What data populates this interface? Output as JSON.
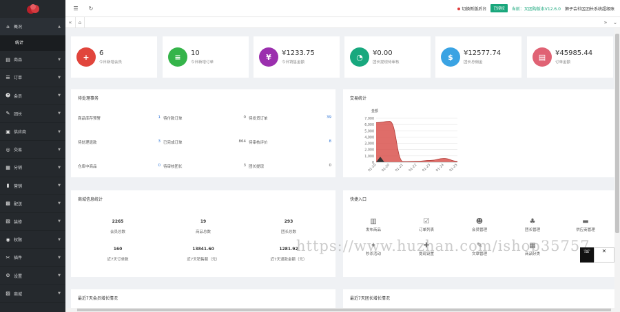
{
  "sidebar": {
    "items": [
      {
        "label": "概况",
        "icon": "home-icon",
        "glyph": "⌂",
        "arrow": "▲"
      },
      {
        "label": "商品",
        "icon": "product-icon",
        "glyph": "▤",
        "arrow": "▼"
      },
      {
        "label": "订单",
        "icon": "order-icon",
        "glyph": "☰",
        "arrow": "▼"
      },
      {
        "label": "会员",
        "icon": "member-icon",
        "glyph": "☻",
        "arrow": "▼"
      },
      {
        "label": "团长",
        "icon": "leader-icon",
        "glyph": "✎",
        "arrow": "▼"
      },
      {
        "label": "供应商",
        "icon": "supplier-icon",
        "glyph": "▣",
        "arrow": "▼"
      },
      {
        "label": "交易",
        "icon": "trade-icon",
        "glyph": "◎",
        "arrow": "▼"
      },
      {
        "label": "分销",
        "icon": "distribution-icon",
        "glyph": "▦",
        "arrow": "▼"
      },
      {
        "label": "营销",
        "icon": "marketing-icon",
        "glyph": "▮",
        "arrow": "▼"
      },
      {
        "label": "配送",
        "icon": "delivery-icon",
        "glyph": "▩",
        "arrow": "▼"
      },
      {
        "label": "装修",
        "icon": "decoration-icon",
        "glyph": "▧",
        "arrow": "▼"
      },
      {
        "label": "权限",
        "icon": "permission-icon",
        "glyph": "◉",
        "arrow": "▼"
      },
      {
        "label": "插件",
        "icon": "plugin-icon",
        "glyph": "✂",
        "arrow": "▼"
      },
      {
        "label": "设置",
        "icon": "settings-icon",
        "glyph": "⚙",
        "arrow": "▼"
      },
      {
        "label": "商城",
        "icon": "mall-icon",
        "glyph": "▨",
        "arrow": "▼"
      }
    ],
    "sub_item": "统计"
  },
  "topbar": {
    "switch_text": "切换新版后台",
    "badge": "已授权",
    "version": "当前：又团购版本V12.6.0",
    "account": "狮子会社区团长系统超级账"
  },
  "stats": [
    {
      "value": "6",
      "label": "今日新增会员",
      "color": "#e1453c",
      "icon": "user-add-icon",
      "glyph": "+"
    },
    {
      "value": "10",
      "label": "今日新增订单",
      "color": "#35b44a",
      "icon": "document-icon",
      "glyph": "≡"
    },
    {
      "value": "¥1233.75",
      "label": "今日销售金额",
      "color": "#9b2fae",
      "icon": "yuan-icon",
      "glyph": "¥"
    },
    {
      "value": "¥0.00",
      "label": "团长提现待审核",
      "color": "#18a87e",
      "icon": "pie-icon",
      "glyph": "◔"
    },
    {
      "value": "¥12577.74",
      "label": "团长总佣金",
      "color": "#3aa3e3",
      "icon": "money-bag-icon",
      "glyph": "$"
    },
    {
      "value": "¥45985.44",
      "label": "订单金额",
      "color": "#e06274",
      "icon": "receipt-icon",
      "glyph": "▤"
    }
  ],
  "todo": {
    "title": "待处理事务",
    "items": [
      {
        "label": "商品库存预警",
        "value": "1",
        "highlight": true
      },
      {
        "label": "待付款订单",
        "value": "0",
        "highlight": false
      },
      {
        "label": "待发货订单",
        "value": "39",
        "highlight": true
      },
      {
        "label": "待处理退款",
        "value": "3",
        "highlight": true
      },
      {
        "label": "已完成订单",
        "value": "864",
        "highlight": false
      },
      {
        "label": "待审核评价",
        "value": "8",
        "highlight": true
      },
      {
        "label": "仓库中商品",
        "value": "0",
        "highlight": true
      },
      {
        "label": "待审核团长",
        "value": "3",
        "highlight": false
      },
      {
        "label": "团长提现",
        "value": "0",
        "highlight": false
      }
    ]
  },
  "trade_chart": {
    "title": "交易统计",
    "unit_label": "金额"
  },
  "chart_data": {
    "type": "area",
    "x": [
      "01-19",
      "01-20",
      "01-21",
      "01-22",
      "01-23",
      "01-24",
      "01-25"
    ],
    "series": [
      {
        "values": [
          6300,
          6500,
          100,
          150,
          280,
          600,
          150
        ],
        "color": "#d9534f"
      }
    ],
    "ylim": [
      0,
      7000
    ],
    "yticks": [
      "7,000",
      "6,000",
      "5,000",
      "4,000",
      "3,000",
      "2,000",
      "1,000",
      "0"
    ],
    "grid": true
  },
  "analysis": {
    "title": "商城信息统计",
    "items": [
      {
        "value": "2265",
        "label": "会员总数"
      },
      {
        "value": "19",
        "label": "商品总数"
      },
      {
        "value": "293",
        "label": "团长总数"
      },
      {
        "value": "160",
        "label": "近7天订单数"
      },
      {
        "value": "13841.60",
        "label": "近7天销售额（元）"
      },
      {
        "value": "1281.92",
        "label": "近7天退款金额（元）"
      }
    ]
  },
  "quick": {
    "title": "快捷入口",
    "items": [
      {
        "label": "发布商品",
        "icon": "barcode-icon",
        "glyph": "▥"
      },
      {
        "label": "订单列表",
        "icon": "clipboard-icon",
        "glyph": "☑"
      },
      {
        "label": "会员管理",
        "icon": "member-manage-icon",
        "glyph": "☻"
      },
      {
        "label": "团长管理",
        "icon": "org-chart-icon",
        "glyph": "♣"
      },
      {
        "label": "供应商管理",
        "icon": "truck-icon",
        "glyph": "▬"
      },
      {
        "label": "秒杀活动",
        "icon": "flash-icon",
        "glyph": "✦"
      },
      {
        "label": "提现设置",
        "icon": "withdraw-icon",
        "glyph": "✚"
      },
      {
        "label": "文章管理",
        "icon": "article-icon",
        "glyph": "✎"
      },
      {
        "label": "商品分类",
        "icon": "category-icon",
        "glyph": "▦"
      },
      {
        "label": "",
        "icon": "more-icon",
        "glyph": ""
      }
    ]
  },
  "bottom": {
    "member_growth": "最近7天会员增长情况",
    "leader_growth": "最近7天团长增长情况"
  },
  "watermark": "https://www.huzhan.com/ishop35757"
}
